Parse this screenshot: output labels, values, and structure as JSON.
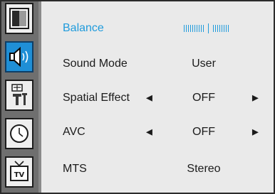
{
  "sidebar": {
    "tabs": [
      {
        "icon": "picture-icon",
        "active": false
      },
      {
        "icon": "speaker-icon",
        "active": true
      },
      {
        "icon": "tools-icon",
        "active": false
      },
      {
        "icon": "clock-icon",
        "active": false
      },
      {
        "icon": "tv-icon",
        "active": false
      }
    ]
  },
  "menu": {
    "balance": {
      "label": "Balance",
      "left_ticks": 10,
      "right_ticks": 8
    },
    "sound_mode": {
      "label": "Sound Mode",
      "value": "User"
    },
    "spatial_effect": {
      "label": "Spatial Effect",
      "value": "OFF",
      "left_arrow": "◄",
      "right_arrow": "►"
    },
    "avc": {
      "label": "AVC",
      "value": "OFF",
      "left_arrow": "◄",
      "right_arrow": "►"
    },
    "mts": {
      "label": "MTS",
      "value": "Stereo"
    }
  },
  "colors": {
    "accent": "#1f9bdc",
    "sidebar": "#6f6f6f",
    "panel": "#eaeaea"
  }
}
